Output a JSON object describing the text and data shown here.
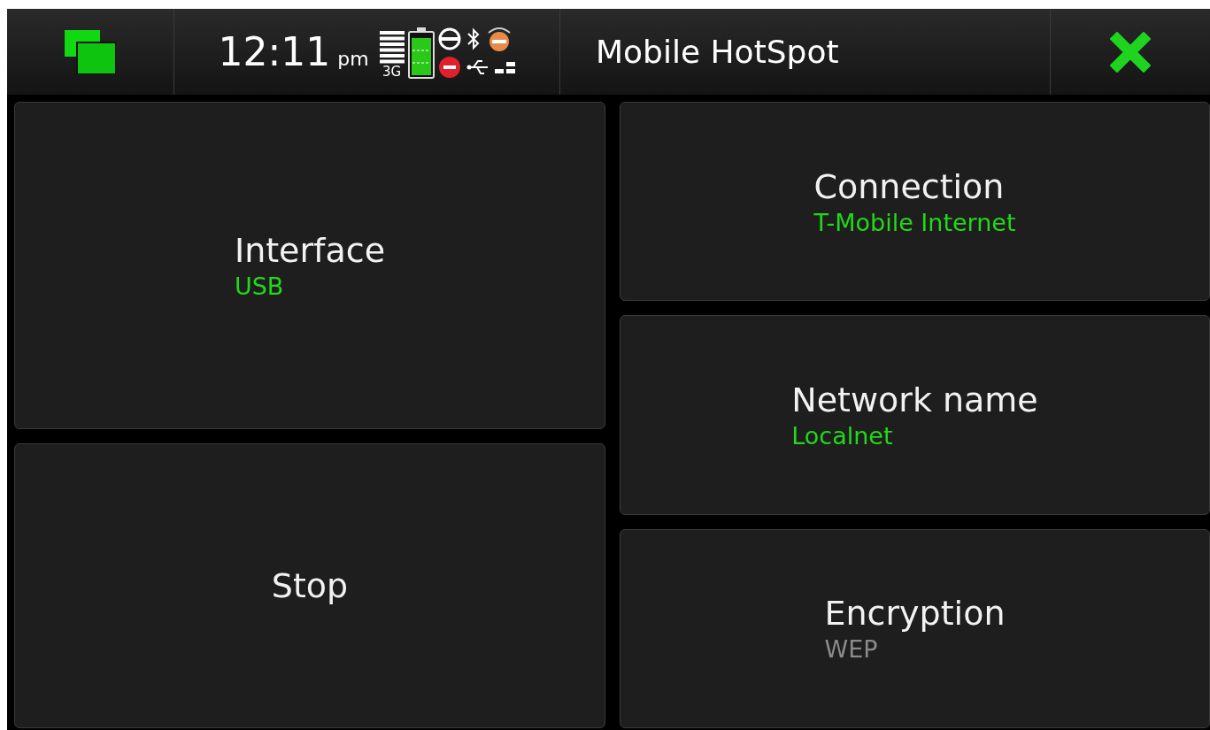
{
  "status_bar": {
    "time": "12:11",
    "meridiem": "pm",
    "network_type": "3G"
  },
  "title": "Mobile HotSpot",
  "left_tiles": [
    {
      "kind": "setting",
      "label": "Interface",
      "value": "USB",
      "disabled": false
    },
    {
      "kind": "action",
      "label": "Stop"
    }
  ],
  "right_tiles": [
    {
      "kind": "setting",
      "label": "Connection",
      "value": "T-Mobile Internet",
      "disabled": false
    },
    {
      "kind": "setting",
      "label": "Network name",
      "value": "Localnet",
      "disabled": false
    },
    {
      "kind": "setting",
      "label": "Encryption",
      "value": "WEP",
      "disabled": true
    }
  ]
}
